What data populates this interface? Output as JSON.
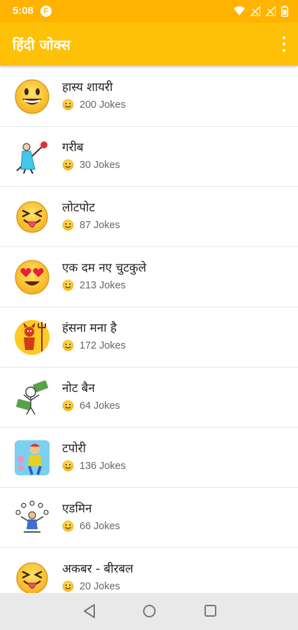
{
  "status_bar": {
    "time": "5:08",
    "app_notification_letter": "F"
  },
  "app_bar": {
    "title": "हिंदी जोक्स",
    "menu_icon": "more-vert-icon"
  },
  "categories": [
    {
      "title": "हास्य शायरी",
      "count": "200 Jokes",
      "icon": "grinning-emoji-icon"
    },
    {
      "title": "गरीब",
      "count": "30 Jokes",
      "icon": "poor-man-bundle-icon"
    },
    {
      "title": "लोटपोट",
      "count": "87 Jokes",
      "icon": "tongue-out-emoji-icon"
    },
    {
      "title": "एक दम नए चुटकुले",
      "count": "213 Jokes",
      "icon": "heart-eyes-emoji-icon"
    },
    {
      "title": "हंसना मना है",
      "count": "172 Jokes",
      "icon": "devil-with-trident-icon"
    },
    {
      "title": "नोट बैन",
      "count": "64 Jokes",
      "icon": "money-notes-man-icon"
    },
    {
      "title": "टपोरी",
      "count": "136 Jokes",
      "icon": "tapori-man-icon"
    },
    {
      "title": "एडमिन",
      "count": "66 Jokes",
      "icon": "juggling-admin-icon"
    },
    {
      "title": "अकबर - बीरबल",
      "count": "20 Jokes",
      "icon": "tongue-out-emoji-icon"
    }
  ],
  "colors": {
    "status_bar": "#FFB300",
    "app_bar": "#FFC107",
    "emoji_yellow": "#FFCB2E"
  },
  "nav": {
    "back": "back-triangle-icon",
    "home": "home-circle-icon",
    "recents": "recents-square-icon"
  }
}
